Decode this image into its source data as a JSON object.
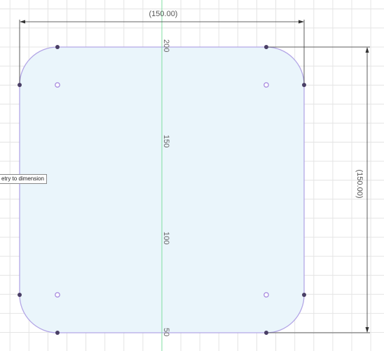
{
  "sketch": {
    "horizontal_dimension": "(150.00)",
    "vertical_dimension": "(150.00)",
    "tooltip": "etry to dimension",
    "ruler_labels": [
      "200",
      "150",
      "100",
      "50"
    ],
    "colors": {
      "grid": "#e4e4e4",
      "profile_fill": "#eaf5fb",
      "profile_stroke": "#b3a6e6",
      "y_axis": "#7fdfa0",
      "point": "#4a3f66",
      "center_point": "#a98fe0",
      "dimension_line": "#333333"
    }
  }
}
